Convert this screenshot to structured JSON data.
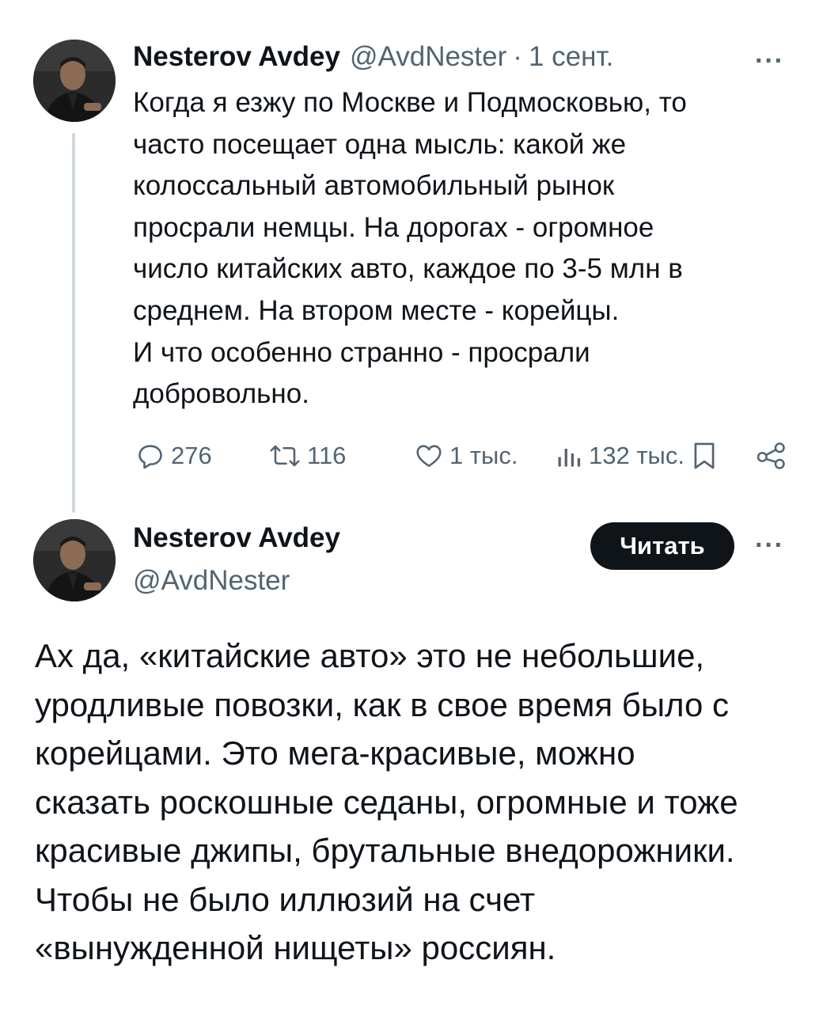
{
  "tweet1": {
    "author_name": "Nesterov Avdey",
    "handle": "@AvdNester",
    "separator": "·",
    "time": "1 сент.",
    "more": "···",
    "text": "Когда я езжу по Москве и Подмосковью, то\nчасто посещает одна мысль: какой же\nколоссальный автомобильный рынок\nпросрали немцы. На дорогах - огромное\nчисло китайских авто, каждое по 3-5 млн в\nсреднем. На втором месте - корейцы.\nИ что особенно странно - просрали\nдобровольно.",
    "stats": {
      "replies": "276",
      "reposts": "116",
      "likes": "1 тыс.",
      "views": "132 тыс."
    }
  },
  "tweet2": {
    "author_name": "Nesterov Avdey",
    "handle": "@AvdNester",
    "follow_label": "Читать",
    "more": "···",
    "text": "Ах да, «китайские авто» это не небольшие,\nуродливые повозки, как в свое время было с\nкорейцами. Это мега-красивые, можно\nсказать роскошные седаны, огромные и тоже\nкрасивые джипы, брутальные внедорожники.\nЧтобы не было иллюзий на счет\n«вынужденной нищеты» россиян."
  },
  "icons": {
    "reply": "reply-icon",
    "repost": "repost-icon",
    "like": "heart-icon",
    "views": "views-icon",
    "bookmark": "bookmark-icon",
    "share": "share-icon"
  },
  "colors": {
    "text": "#0f1419",
    "secondary": "#536471",
    "thread_line": "#cfd9de",
    "button_bg": "#0f1419",
    "button_text": "#ffffff"
  }
}
